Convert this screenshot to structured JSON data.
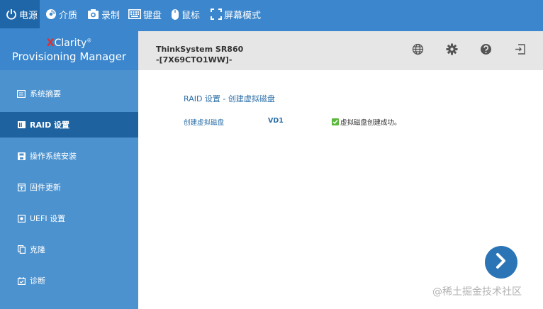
{
  "toolbar": {
    "items": [
      {
        "label": "电源",
        "icon": "power-icon"
      },
      {
        "label": "介质",
        "icon": "media-disc-icon"
      },
      {
        "label": "录制",
        "icon": "camera-icon"
      },
      {
        "label": "键盘",
        "icon": "keyboard-icon"
      },
      {
        "label": "鼠标",
        "icon": "mouse-icon"
      },
      {
        "label": "屏幕模式",
        "icon": "fullscreen-icon"
      }
    ]
  },
  "brand": {
    "x_letter": "X",
    "name_rest": "Clarity",
    "trademark": "®",
    "subtitle": "Provisioning Manager"
  },
  "header": {
    "system_name": "ThinkSystem SR860",
    "machine_type": "-[7X69CTO1WW]-",
    "icons": [
      "globe-icon",
      "gear-icon",
      "help-icon",
      "exit-icon"
    ]
  },
  "sidebar": {
    "items": [
      {
        "label": "系统摘要",
        "icon": "summary-icon"
      },
      {
        "label": "RAID 设置",
        "icon": "raid-icon",
        "active": true
      },
      {
        "label": "操作系统安装",
        "icon": "save-disk-icon"
      },
      {
        "label": "固件更新",
        "icon": "firmware-update-icon"
      },
      {
        "label": "UEFI 设置",
        "icon": "uefi-settings-icon"
      },
      {
        "label": "克隆",
        "icon": "clone-icon"
      },
      {
        "label": "诊断",
        "icon": "diagnostics-icon"
      }
    ]
  },
  "main": {
    "breadcrumb": "RAID 设置 - 创建虚拟磁盘",
    "row": {
      "label": "创建虚拟磁盘",
      "value": "VD1",
      "status": "虚拟磁盘创建成功。"
    }
  },
  "watermark": "@稀土掘金技术社区",
  "colors": {
    "toolbar_bg": "#3b86cc",
    "sidebar_bg": "#4c92cf",
    "sidebar_active": "#1f62a0",
    "header_bg": "#e6e6e6",
    "link_blue": "#2c6fa8",
    "success_green": "#5cb83c",
    "next_button": "#2b75b7"
  }
}
